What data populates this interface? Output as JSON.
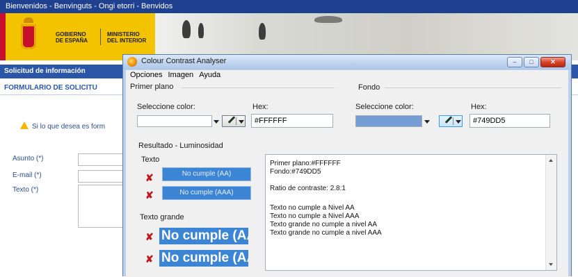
{
  "web": {
    "topbar": "Bienvenidos - Benvinguts - Ongi etorri - Benvidos",
    "gov_line1": "GOBIERNO",
    "gov_line2": "DE ESPAÑA",
    "min_line1": "MINISTERIO",
    "min_line2": "DEL INTERIOR",
    "nav1": "Solicitud de información",
    "nav2": "FORMULARIO DE SOLICITU",
    "warning": "Si lo que desea es form",
    "form": {
      "asunto": "Asunto (*)",
      "email": "E-mail (*)",
      "texto": "Texto (*)"
    },
    "colors": {
      "topbar": "#1f3f8f",
      "nav": "#2b56a8",
      "flag_red": "#c8102e",
      "flag_yellow": "#f4c300"
    }
  },
  "dialog": {
    "title": "Colour Contrast Analyser",
    "menu": [
      "Opciones",
      "Imagen",
      "Ayuda"
    ],
    "foreground": {
      "group_label": "Primer plano",
      "select_label": "Seleccione color:",
      "hex_label": "Hex:",
      "hex_value": "#FFFFFF",
      "swatch": "#FFFFFF"
    },
    "background": {
      "group_label": "Fondo",
      "select_label": "Seleccione color:",
      "hex_label": "Hex:",
      "hex_value": "#749DD5",
      "swatch": "#749DD5"
    },
    "result_label": "Resultado - Luminosidad",
    "texto": {
      "label": "Texto",
      "aa": "No cumple (AA)",
      "aaa": "No cumple (AAA)"
    },
    "texto_grande": {
      "label": "Texto grande",
      "aa": "No cumple (AA",
      "aaa": "No cumple (AA"
    },
    "results_text": {
      "line1": "Primer plano:#FFFFFF",
      "line2": "Fondo:#749DD5",
      "line3": "Ratio de contraste: 2.8:1",
      "line4": "Texto no cumple a Nivel AA",
      "line5": "Texto no cumple a Nivel AAA",
      "line6": "Texto grande no cumple a nivel AA",
      "line7": "Texto grande no cumple a nivel AAA"
    },
    "fail_mark": "✘",
    "titlebar_buttons": {
      "minimize": "–",
      "maximize": "□",
      "close": "✕"
    }
  }
}
